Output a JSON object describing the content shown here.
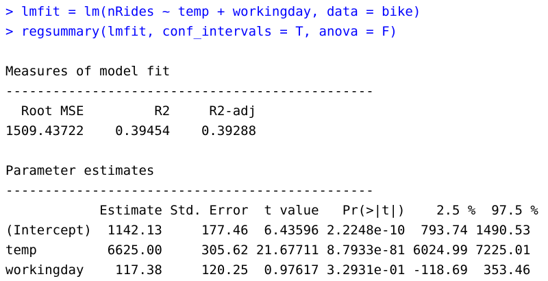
{
  "colors": {
    "command": "#0000ff",
    "output": "#000000",
    "background": "#ffffff"
  },
  "console": {
    "commands": [
      "> lmfit = lm(nRides ~ temp + workingday, data = bike)",
      "> regsummary(lmfit, conf_intervals = T, anova = F)"
    ],
    "model_fit": {
      "heading": "Measures of model fit",
      "rule": "-----------------------------------------------",
      "header": "  Root MSE         R2     R2-adj",
      "row": "1509.43722    0.39454    0.39288"
    },
    "params": {
      "heading": "Parameter estimates",
      "rule": "-----------------------------------------------",
      "header": "            Estimate Std. Error  t value   Pr(>|t|)    2.5 %  97.5 %",
      "rows": [
        "(Intercept)  1142.13     177.46  6.43596 2.2248e-10  793.74 1490.53",
        "temp         6625.00     305.62 21.67711 8.7933e-81 6024.99 7225.01",
        "workingday    117.38     120.25  0.97617 3.2931e-01 -118.69  353.46"
      ]
    }
  }
}
